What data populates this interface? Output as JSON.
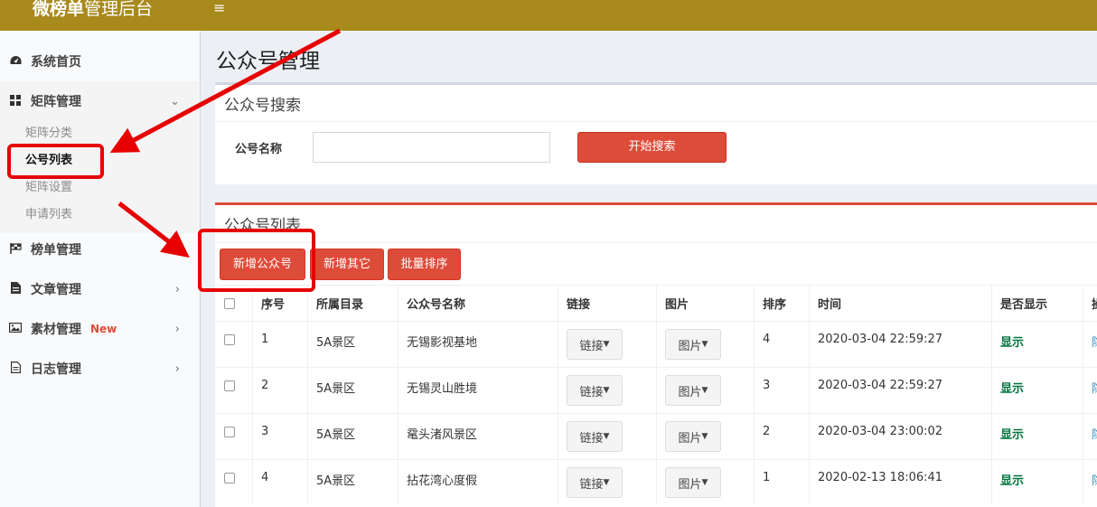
{
  "header": {
    "logo_bold": "微榜单",
    "logo_rest": "管理后台",
    "menu_icon": "≡"
  },
  "sidebar": {
    "items": [
      {
        "label": "系统首页",
        "icon": "dashboard-icon"
      },
      {
        "label": "矩阵管理",
        "icon": "grid-icon"
      },
      {
        "label": "榜单管理",
        "icon": "flag-icon"
      },
      {
        "label": "文章管理",
        "icon": "file-icon"
      },
      {
        "label": "素材管理",
        "icon": "image-icon",
        "badge": "New"
      },
      {
        "label": "日志管理",
        "icon": "doc-icon"
      }
    ],
    "submenu": [
      {
        "label": "矩阵分类"
      },
      {
        "label": "公号列表",
        "active": true
      },
      {
        "label": "矩阵设置"
      },
      {
        "label": "申请列表"
      }
    ]
  },
  "page": {
    "title": "公众号管理"
  },
  "search_box": {
    "title": "公众号搜索",
    "field_label": "公号名称",
    "input_value": "",
    "button_label": "开始搜索"
  },
  "list_box": {
    "title": "公众号列表",
    "buttons": [
      "新增公众号",
      "新增其它",
      "批量排序"
    ],
    "columns": [
      "序号",
      "所属目录",
      "公众号名称",
      "链接",
      "图片",
      "排序",
      "时间",
      "是否显示",
      "操"
    ],
    "rows": [
      {
        "no": "1",
        "dir": "5A景区",
        "name": "无锡影视基地",
        "link": "链接",
        "img": "图片",
        "sort": "4",
        "time": "2020-03-04 22:59:27",
        "show": "显示",
        "op": "隐"
      },
      {
        "no": "2",
        "dir": "5A景区",
        "name": "无锡灵山胜境",
        "link": "链接",
        "img": "图片",
        "sort": "3",
        "time": "2020-03-04 22:59:27",
        "show": "显示",
        "op": "隐"
      },
      {
        "no": "3",
        "dir": "5A景区",
        "name": "鼋头渚风景区",
        "link": "链接",
        "img": "图片",
        "sort": "2",
        "time": "2020-03-04 23:00:02",
        "show": "显示",
        "op": "隐"
      },
      {
        "no": "4",
        "dir": "5A景区",
        "name": "拈花湾心度假",
        "link": "链接",
        "img": "图片",
        "sort": "1",
        "time": "2020-02-13 18:06:41",
        "show": "显示",
        "op": "隐"
      }
    ]
  },
  "colors": {
    "topbar": "#a8891c",
    "danger": "#dd4b39",
    "annotation": "#e60000",
    "success": "#00733e"
  }
}
